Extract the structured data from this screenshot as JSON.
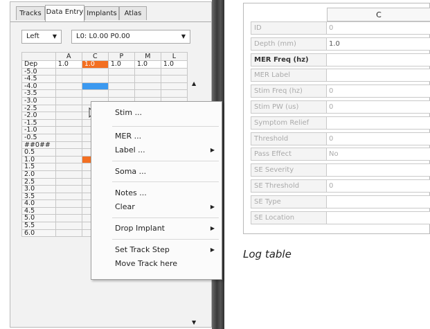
{
  "tabs": [
    "Tracks",
    "Data Entry",
    "Implants",
    "Atlas"
  ],
  "active_tab": "Data Entry",
  "side_select": "Left",
  "location_select": "L0: L0.00 P0.00",
  "grid": {
    "columns": [
      "",
      "A",
      "C",
      "P",
      "M",
      "L"
    ],
    "depth_row": [
      "Dep",
      "1.0",
      "1.0",
      "1.0",
      "1.0",
      "1.0"
    ],
    "rows": [
      "-5.0",
      "-4.5",
      "-4.0",
      "-3.5",
      "-3.0",
      "-2.5",
      "-2.0",
      "-1.5",
      "-1.0",
      "-0.5",
      "##0##",
      "0.5",
      "1.0",
      "1.5",
      "2.0",
      "2.5",
      "3.0",
      "3.5",
      "4.0",
      "4.5",
      "5.0",
      "5.5",
      "6.0"
    ]
  },
  "context_menu": {
    "items": [
      {
        "label": "Stim ...",
        "submenu": false
      },
      {
        "label": "MER ...",
        "submenu": false
      },
      {
        "label": "Label ...",
        "submenu": true
      },
      {
        "label": "Soma ...",
        "submenu": false
      },
      {
        "label": "Notes ...",
        "submenu": false
      },
      {
        "label": "Clear",
        "submenu": true
      },
      {
        "label": "Drop Implant",
        "submenu": true
      },
      {
        "label": "Set Track Step",
        "submenu": true
      },
      {
        "label": "Move Track here",
        "submenu": false
      }
    ]
  },
  "log_table": {
    "column": "C",
    "rows": [
      {
        "label": "ID",
        "value": "0"
      },
      {
        "label": "Depth (mm)",
        "value": "1.0"
      },
      {
        "label": "MER Freq (hz)",
        "value": ""
      },
      {
        "label": "MER Label",
        "value": ""
      },
      {
        "label": "Stim Freq (hz)",
        "value": "0"
      },
      {
        "label": "Stim PW (us)",
        "value": "0"
      },
      {
        "label": "Symptom Relief",
        "value": ""
      },
      {
        "label": "Threshold",
        "value": "0"
      },
      {
        "label": "Pass Effect",
        "value": "No"
      },
      {
        "label": "SE Severity",
        "value": ""
      },
      {
        "label": "SE Threshold",
        "value": "0"
      },
      {
        "label": "SE Type",
        "value": ""
      },
      {
        "label": "SE Location",
        "value": ""
      }
    ]
  },
  "caption": "Log table",
  "colors": {
    "orange": "#f36f21",
    "blue": "#3b99f0"
  },
  "icons": {
    "submenu": "chevron-right-icon",
    "dropdown": "chevron-down-icon",
    "cursor": "mouse-pointer-icon"
  }
}
